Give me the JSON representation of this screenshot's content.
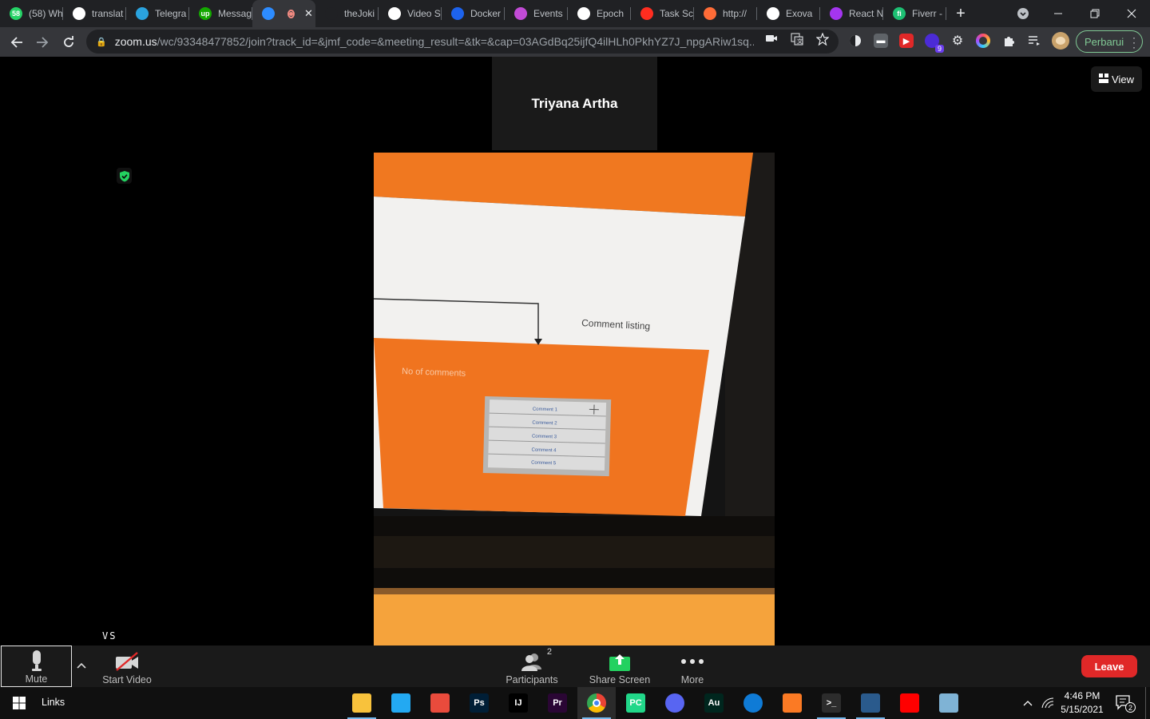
{
  "browser": {
    "tabs": [
      {
        "title": "(58) Wh",
        "favicon": "whatsapp-icon",
        "color": "#25d366",
        "badge": "58"
      },
      {
        "title": "translat",
        "favicon": "google-icon",
        "color": "#ffffff"
      },
      {
        "title": "Telegra",
        "favicon": "telegram-icon",
        "color": "#2aa3df"
      },
      {
        "title": "Messag",
        "favicon": "upwork-icon",
        "color": "#14a800",
        "badge": "up"
      },
      {
        "title": "U",
        "favicon": "zoom-icon",
        "color": "#2d8cff",
        "active": true
      },
      {
        "title": "theJoki",
        "favicon": "tree-icon",
        "color": "#202124"
      },
      {
        "title": "Video S",
        "favicon": "medium-icon",
        "color": "#ffffff"
      },
      {
        "title": "Docker",
        "favicon": "docker-icon",
        "color": "#1d63ed"
      },
      {
        "title": "Events",
        "favicon": "events-icon",
        "color": "#c24bd6"
      },
      {
        "title": "Epoch",
        "favicon": "epoch-icon",
        "color": "#ffffff"
      },
      {
        "title": "Task Sc",
        "favicon": "laravel-icon",
        "color": "#ff2d20"
      },
      {
        "title": "http://",
        "favicon": "postman-icon",
        "color": "#ff6c37"
      },
      {
        "title": "Exova",
        "favicon": "exova-icon",
        "color": "#ffffff"
      },
      {
        "title": "React N",
        "favicon": "udemy-icon",
        "color": "#a435f0"
      },
      {
        "title": "Fiverr -",
        "favicon": "fiverr-icon",
        "color": "#1dbf73",
        "badge": "fi"
      }
    ],
    "url_host": "zoom.us",
    "url_path": "/wc/93348477852/join?track_id=&jmf_code=&meeting_result=&tk=&cap=03AGdBq25ijfQ4ilHLh0PkhYZ7J_npgARiw1sq...",
    "update_label": "Perbarui",
    "extension_badge": "9"
  },
  "meeting": {
    "participant_name": "Triyana Artha",
    "view_label": "View",
    "self_label": "VS",
    "shared_video": {
      "comment_listing": "Comment listing",
      "no_of_comments": "No of comments",
      "comments": [
        "Comment 1",
        "Comment 2",
        "Comment 3",
        "Comment 4",
        "Comment 5"
      ]
    }
  },
  "controls": {
    "mute_label": "Mute",
    "start_video_label": "Start Video",
    "participants_label": "Participants",
    "participants_count": "2",
    "share_label": "Share Screen",
    "more_label": "More",
    "leave_label": "Leave"
  },
  "taskbar": {
    "links_label": "Links",
    "apps": [
      {
        "name": "file-explorer-icon",
        "color": "#f8c23c",
        "glyph": "",
        "running": true
      },
      {
        "name": "vscode-icon",
        "color": "#23a9f2",
        "glyph": "",
        "running": false
      },
      {
        "name": "app-red-icon",
        "color": "#e94b3c",
        "glyph": "",
        "running": false
      },
      {
        "name": "photoshop-icon",
        "color": "#001e36",
        "glyph": "Ps",
        "running": false
      },
      {
        "name": "intellij-icon",
        "color": "#000000",
        "glyph": "IJ",
        "running": false
      },
      {
        "name": "premiere-icon",
        "color": "#2a0634",
        "glyph": "Pr",
        "running": false
      },
      {
        "name": "chrome-icon",
        "color": "#4285f4",
        "glyph": "",
        "running": true,
        "active": true
      },
      {
        "name": "pycharm-icon",
        "color": "#21d789",
        "glyph": "PC",
        "running": false
      },
      {
        "name": "discord-icon",
        "color": "#5865f2",
        "glyph": "",
        "running": false
      },
      {
        "name": "audition-icon",
        "color": "#00261e",
        "glyph": "Au",
        "running": false
      },
      {
        "name": "edge-icon",
        "color": "#0f7bd6",
        "glyph": "",
        "running": false
      },
      {
        "name": "xampp-icon",
        "color": "#fb7a24",
        "glyph": "",
        "running": false
      },
      {
        "name": "terminal-icon",
        "color": "#2c2c2c",
        "glyph": ">_",
        "running": true
      },
      {
        "name": "mysql-workbench-icon",
        "color": "#2a5a8c",
        "glyph": "",
        "running": true
      },
      {
        "name": "youtube-icon",
        "color": "#ff0000",
        "glyph": "",
        "running": false
      },
      {
        "name": "notepad-icon",
        "color": "#7fb3d5",
        "glyph": "",
        "running": false
      }
    ],
    "time": "4:46 PM",
    "date": "5/15/2021",
    "notification_count": "2"
  }
}
